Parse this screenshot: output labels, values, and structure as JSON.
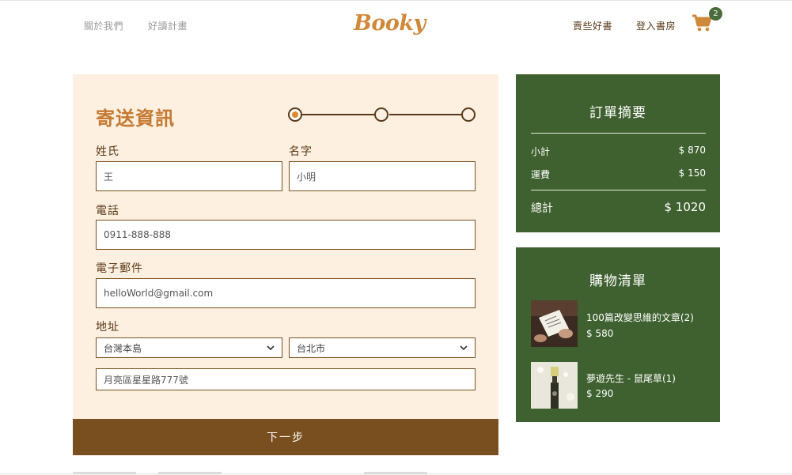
{
  "header": {
    "nav_left": [
      "關於我們",
      "好讀計畫"
    ],
    "logo": "Booky",
    "nav_right": [
      "賣些好書",
      "登入書房"
    ],
    "cart_count": "2"
  },
  "form": {
    "title": "寄送資訊",
    "steps_total": 3,
    "current_step": 1,
    "last_name_label": "姓氏",
    "last_name_value": "王",
    "first_name_label": "名字",
    "first_name_value": "小明",
    "phone_label": "電話",
    "phone_value": "0911-888-888",
    "email_label": "電子郵件",
    "email_value": "helloWorld@gmail.com",
    "address_label": "地址",
    "region_value": "台灣本島",
    "city_value": "台北市",
    "street_value": "月亮區星星路777號",
    "next_label": "下一步"
  },
  "summary": {
    "title": "訂單摘要",
    "subtotal_label": "小計",
    "subtotal_value": "$ 870",
    "shipping_label": "運費",
    "shipping_value": "$ 150",
    "total_label": "總計",
    "total_value": "$ 1020"
  },
  "cart_list": {
    "title": "購物清單",
    "items": [
      {
        "name": "100篇改變思維的文章(2)",
        "price": "$ 580"
      },
      {
        "name": "夢遊先生 - 鼠尾草(1)",
        "price": "$ 290"
      }
    ]
  },
  "colors": {
    "brand_orange": "#d0883a",
    "brown": "#7a4f1f",
    "green": "#3f6130",
    "cream": "#fdf0e0"
  }
}
